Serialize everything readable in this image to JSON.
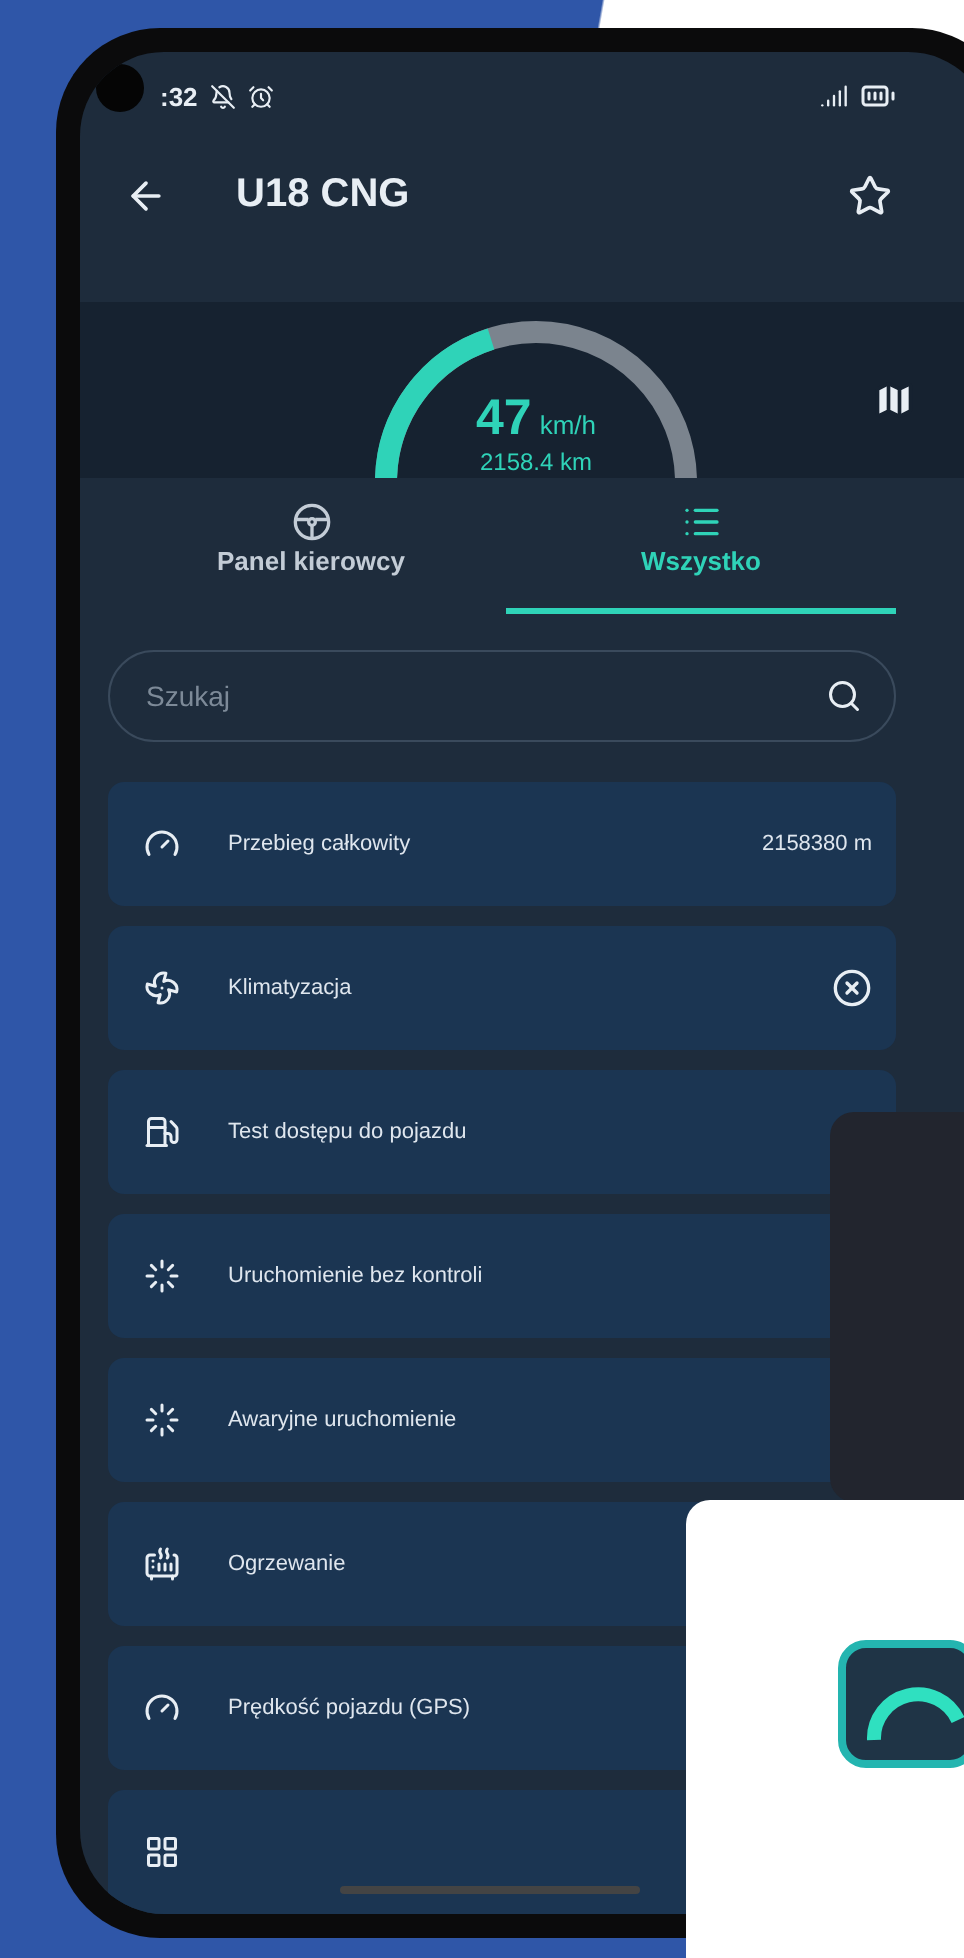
{
  "status_bar": {
    "time": ":32"
  },
  "app_bar": {
    "title": "U18 CNG",
    "favorite": false
  },
  "gauge": {
    "speed": "47",
    "unit": "km/h",
    "distance": "2158.4 km",
    "level": 0.35
  },
  "tabs": [
    {
      "label": "Panel kierowcy",
      "selected": false
    },
    {
      "label": "Wszystko",
      "selected": true
    }
  ],
  "search": {
    "placeholder": "Szukaj"
  },
  "items": [
    {
      "kind": "value",
      "label": "Przebieg całkowity",
      "value": "2158380 m"
    },
    {
      "kind": "off",
      "label": "Klimatyzacja"
    },
    {
      "kind": "plain",
      "label": "Test dostępu do pojazdu"
    },
    {
      "kind": "plain",
      "label": "Uruchomienie bez kontroli"
    },
    {
      "kind": "plain",
      "label": "Awaryjne uruchomienie"
    },
    {
      "kind": "plain",
      "label": "Ogrzewanie"
    },
    {
      "kind": "plain",
      "label": "Prędkość pojazdu (GPS)"
    },
    {
      "kind": "plain"
    }
  ]
}
